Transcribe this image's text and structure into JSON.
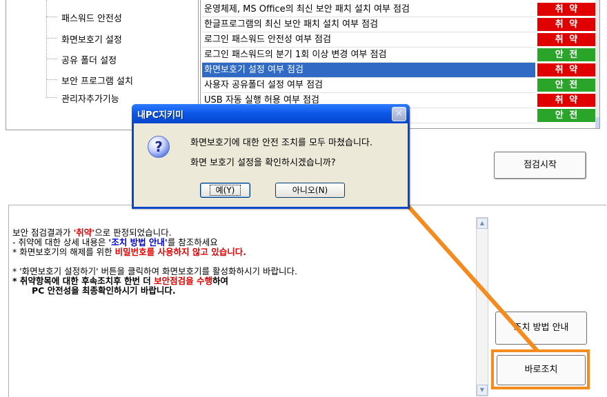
{
  "tree": {
    "items": [
      {
        "label": "패스워드 안전성"
      },
      {
        "label": "화면보호기 설정"
      },
      {
        "label": "공유 폴더 설정"
      },
      {
        "label": "보안 프로그램 설치"
      },
      {
        "label": "관리자추가기능"
      }
    ]
  },
  "checklist": {
    "rows": [
      {
        "title": "운영체제, MS Office의 최신 보안 패치 설치 여부 점검",
        "status": "취 약",
        "status_type": "red"
      },
      {
        "title": "한글프로그램의 최신 보안 패치 설치 여부 점검",
        "status": "취 약",
        "status_type": "red"
      },
      {
        "title": "로그인 패스워드 안전성 여부 점검",
        "status": "취 약",
        "status_type": "red"
      },
      {
        "title": "로그인 패스워드의 분기 1회 이상 변경 여부 점검",
        "status": "안 전",
        "status_type": "green"
      },
      {
        "title": "화면보호기 설정 여부 점검",
        "status": "취 약",
        "status_type": "red",
        "selected": true
      },
      {
        "title": "사용자 공유폴더 설정 여부 점검",
        "status": "안 전",
        "status_type": "green"
      },
      {
        "title": "USB 자동 실행 허용 여부 점검",
        "status": "취 약",
        "status_type": "red"
      },
      {
        "title": "",
        "status": "안 전",
        "status_type": "green"
      }
    ],
    "colors": {
      "red": "#e00000",
      "green": "#2aa52a",
      "selected": "#316ac5"
    }
  },
  "buttons": {
    "start": "점검시작",
    "guide": "조치 방법 안내",
    "fix": "바로조치"
  },
  "result": {
    "line1_a": "보안 점검결과가 ",
    "line1_b": "'취약'",
    "line1_c": "으로 판정되었습니다.",
    "line2_a": "- 취약에 대한 상세 내용은 ",
    "line2_b": "'조치 방법 안내'",
    "line2_c": "를 참조하세요",
    "line3_a": "* 화면보호기의 해제를 위한 ",
    "line3_b": "비밀번호를 사용하지 않고 있습니다.",
    "line4": "* '화면보호기 설정하기' 버튼을 클릭하여 화면보호기를 활성화하시기 바랍니다.",
    "line5_a": "* 취약항목에 대한 후속조치후 한번 더 ",
    "line5_b": "보안점검을 수행",
    "line5_c": "하여",
    "line6": "PC 안전성을 최종확인하시기 바랍니다."
  },
  "dialog": {
    "title": "내PC지키미",
    "icon": "question-icon",
    "message1": "화면보호기에 대한 안전 조치를 모두 마쳤습니다.",
    "message2": "화면 보호기 설정을 확인하시겠습니까?",
    "yes": "예(Y)",
    "no": "아니오(N)"
  },
  "annotation": {
    "arrow_color": "#f58a1f"
  }
}
